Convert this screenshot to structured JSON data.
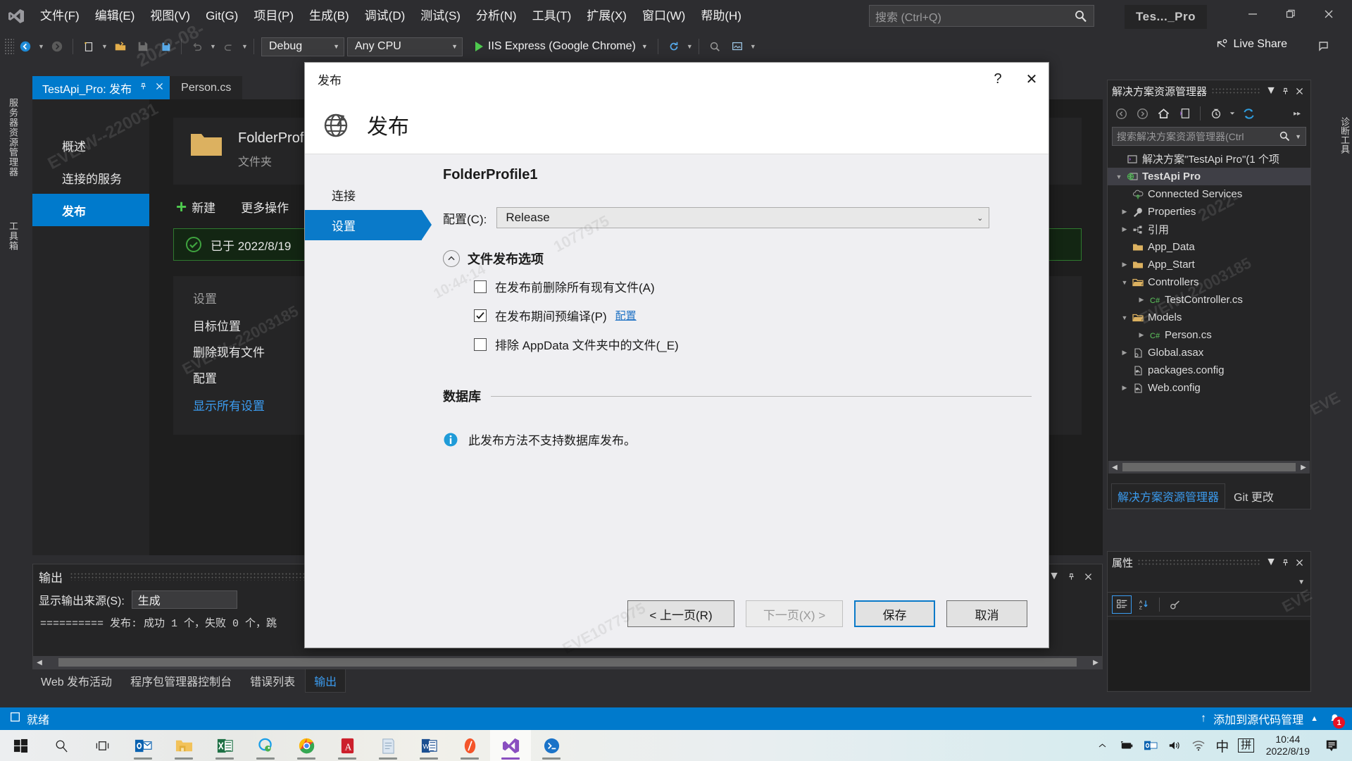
{
  "titlebar": {
    "menu": [
      "文件(F)",
      "编辑(E)",
      "视图(V)",
      "Git(G)",
      "项目(P)",
      "生成(B)",
      "调试(D)",
      "测试(S)",
      "分析(N)",
      "工具(T)",
      "扩展(X)",
      "窗口(W)",
      "帮助(H)"
    ],
    "search_placeholder": "搜索 (Ctrl+Q)",
    "window_title": "Tes..._Pro"
  },
  "toolbar": {
    "configuration": "Debug",
    "platform": "Any CPU",
    "run_target": "IIS Express (Google Chrome)",
    "live_share": "Live Share"
  },
  "left_strips": {
    "server_explorer": "服务器资源管理器",
    "toolbox": "工具箱"
  },
  "doc_tabs": [
    {
      "label": "TestApi_Pro: 发布",
      "active": true
    },
    {
      "label": "Person.cs",
      "active": false
    }
  ],
  "publish_page": {
    "side_items": [
      {
        "label": "概述",
        "active": false
      },
      {
        "label": "连接的服务",
        "active": false
      },
      {
        "label": "发布",
        "active": true
      }
    ],
    "profile_name": "FolderProfile",
    "profile_type": "文件夹",
    "actions": [
      "新建",
      "更多操作"
    ],
    "status_text": "已于 2022/8/19",
    "settings_header": "设置",
    "settings_rows": [
      "目标位置",
      "删除现有文件",
      "配置"
    ],
    "settings_link": "显示所有设置"
  },
  "output_pane": {
    "title": "输出",
    "source_label": "显示输出来源(S):",
    "source_value": "生成",
    "log_line": "========== 发布: 成功 1 个，失败 0 个，跳"
  },
  "dock_tabs": [
    {
      "label": "Web 发布活动",
      "active": false
    },
    {
      "label": "程序包管理器控制台",
      "active": false
    },
    {
      "label": "错误列表",
      "active": false
    },
    {
      "label": "输出",
      "active": true
    }
  ],
  "solution_explorer": {
    "title": "解决方案资源管理器",
    "search_placeholder": "搜索解决方案资源管理器(Ctrl",
    "tree": [
      {
        "label": "解决方案\"TestApi Pro\"(1 个项",
        "indent": 0,
        "arrow": "",
        "icon": "solution-icon",
        "selected": false,
        "bold": false
      },
      {
        "label": "TestApi Pro",
        "indent": 1,
        "arrow": "▼",
        "icon": "web-project-icon",
        "selected": true,
        "bold": true
      },
      {
        "label": "Connected Services",
        "indent": 2,
        "arrow": "",
        "icon": "cloud-icon",
        "selected": false,
        "bold": false
      },
      {
        "label": "Properties",
        "indent": 2,
        "arrow": "▶",
        "icon": "wrench-icon",
        "selected": false,
        "bold": false
      },
      {
        "label": "引用",
        "indent": 2,
        "arrow": "▶",
        "icon": "references-icon",
        "selected": false,
        "bold": false
      },
      {
        "label": "App_Data",
        "indent": 2,
        "arrow": "",
        "icon": "folder-icon",
        "selected": false,
        "bold": false
      },
      {
        "label": "App_Start",
        "indent": 2,
        "arrow": "▶",
        "icon": "folder-icon",
        "selected": false,
        "bold": false
      },
      {
        "label": "Controllers",
        "indent": 2,
        "arrow": "▼",
        "icon": "folder-open-icon",
        "selected": false,
        "bold": false
      },
      {
        "label": "TestController.cs",
        "indent": 3,
        "arrow": "▶",
        "icon": "csharp-icon",
        "selected": false,
        "bold": false
      },
      {
        "label": "Models",
        "indent": 2,
        "arrow": "▼",
        "icon": "folder-open-icon",
        "selected": false,
        "bold": false
      },
      {
        "label": "Person.cs",
        "indent": 3,
        "arrow": "▶",
        "icon": "csharp-icon",
        "selected": false,
        "bold": false
      },
      {
        "label": "Global.asax",
        "indent": 2,
        "arrow": "▶",
        "icon": "asax-icon",
        "selected": false,
        "bold": false
      },
      {
        "label": "packages.config",
        "indent": 2,
        "arrow": "",
        "icon": "config-icon",
        "selected": false,
        "bold": false
      },
      {
        "label": "Web.config",
        "indent": 2,
        "arrow": "▶",
        "icon": "config-icon",
        "selected": false,
        "bold": false
      }
    ],
    "bottom_tabs": [
      {
        "label": "解决方案资源管理器",
        "active": true
      },
      {
        "label": "Git 更改",
        "active": false
      }
    ]
  },
  "properties_panel": {
    "title": "属性"
  },
  "diagnostics_strip": "诊断工具",
  "vs_status": {
    "ready": "就绪",
    "source_control": "添加到源代码管理",
    "notification_count": "1"
  },
  "modal": {
    "title": "发布",
    "heading": "发布",
    "help_glyph": "?",
    "close_glyph": "✕",
    "wizard_steps": [
      {
        "label": "连接",
        "active": false
      },
      {
        "label": "设置",
        "active": true
      }
    ],
    "profile_name": "FolderProfile1",
    "config_label": "配置(C):",
    "config_value": "Release",
    "group_title": "文件发布选项",
    "checkboxes": [
      {
        "label": "在发布前删除所有现有文件(A)",
        "checked": false,
        "link": ""
      },
      {
        "label": "在发布期间预编译(P)",
        "checked": true,
        "link": "配置"
      },
      {
        "label": "排除 AppData 文件夹中的文件(_E)",
        "checked": false,
        "link": ""
      }
    ],
    "database_section_title": "数据库",
    "database_info": "此发布方法不支持数据库发布。",
    "buttons": [
      {
        "label": "< 上一页(R)",
        "state": "normal"
      },
      {
        "label": "下一页(X) >",
        "state": "disabled"
      },
      {
        "label": "保存",
        "state": "primary"
      },
      {
        "label": "取消",
        "state": "normal"
      }
    ]
  },
  "taskbar": {
    "icons": [
      "start-icon",
      "search-icon",
      "task-view-icon",
      "outlook-icon",
      "file-explorer-icon",
      "excel-icon",
      "qq-icon",
      "chrome-icon",
      "acrobat-icon",
      "notepad-icon",
      "word-icon",
      "editor-icon",
      "visual-studio-icon",
      "app-icon"
    ],
    "tray": [
      "chevron-up-icon",
      "battery-icon",
      "outlook-tray-icon",
      "volume-icon",
      "wifi-icon",
      "ime-chinese-icon",
      "ime-pinyin-icon"
    ],
    "ime_chinese": "中",
    "ime_pinyin": "拼",
    "clock_time": "10:44",
    "clock_date": "2022/8/19"
  },
  "colors": {
    "accent": "#007acc",
    "vs_bg": "#2d2d30",
    "panel_bg": "#252526",
    "editor_bg": "#1e1e1e",
    "dialog_bg": "#efeff2",
    "link": "#1f72c4",
    "success": "#4ec94e",
    "alert": "#e81123"
  }
}
